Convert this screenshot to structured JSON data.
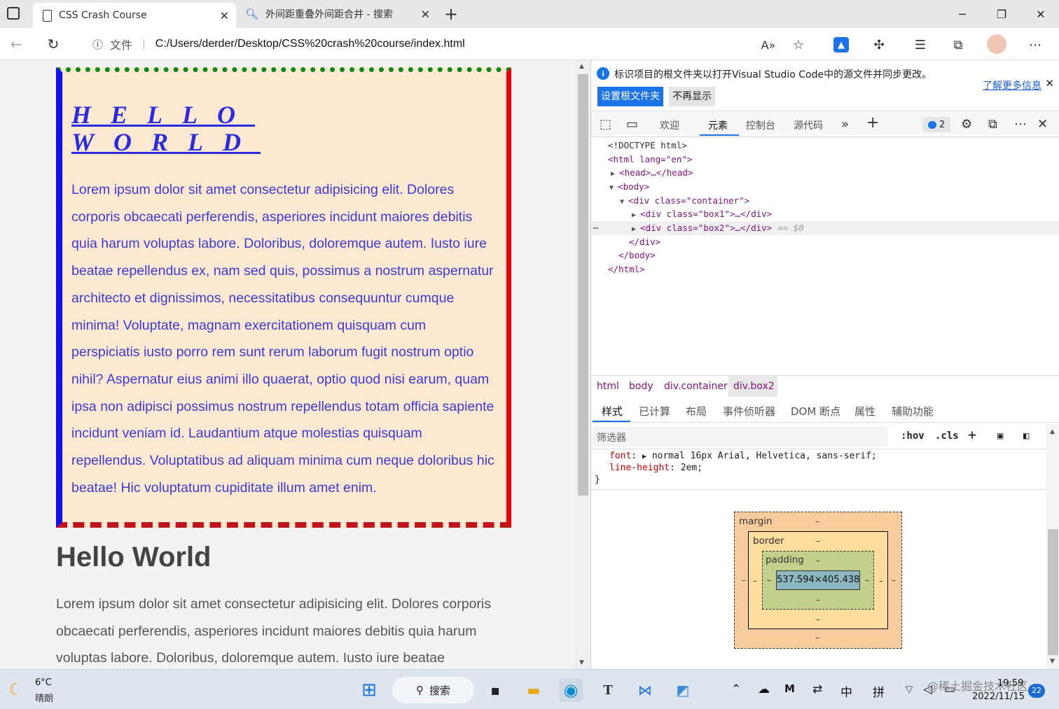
{
  "browser": {
    "tabs": [
      {
        "title": "CSS Crash Course",
        "active": true
      },
      {
        "title": "外间距重叠外间距合并 - 搜索",
        "active": false
      }
    ],
    "address": {
      "file_label": "文件",
      "url": "C:/Users/derder/Desktop/CSS%20crash%20course/index.html"
    },
    "icons": [
      "read-aloud-icon",
      "favorite-add-icon",
      "extension-blue-icon",
      "extensions-icon",
      "favorites-icon",
      "collections-icon",
      "profile-avatar",
      "more-icon"
    ]
  },
  "page": {
    "box1_heading_line1": "HELLO",
    "box1_heading_line2": "WORLD",
    "box1_text": "Lorem ipsum dolor sit amet consectetur adipisicing elit. Dolores corporis obcaecati perferendis, asperiores incidunt maiores debitis quia harum voluptas labore. Doloribus, doloremque autem. Iusto iure beatae repellendus ex, nam sed quis, possimus a nostrum aspernatur architecto et dignissimos, necessitatibus consequuntur cumque minima! Voluptate, magnam exercitationem quisquam cum perspiciatis iusto porro rem sunt rerum laborum fugit nostrum optio nihil? Aspernatur eius animi illo quaerat, optio quod nisi earum, quam ipsa non adipisci possimus nostrum repellendus totam officia sapiente incidunt veniam id. Laudantium atque molestias quisquam repellendus. Voluptatibus ad aliquam minima cum neque doloribus hic beatae! Hic voluptatum cupiditate illum amet enim.",
    "box2_heading": "Hello World",
    "box2_text": "Lorem ipsum dolor sit amet consectetur adipisicing elit. Dolores corporis obcaecati perferendis, asperiores incidunt maiores debitis quia harum voluptas labore. Doloribus, doloremque autem. Iusto iure beatae",
    "colors": {
      "box_bg": "#fde8d2",
      "border_top": "#0a8a1a",
      "border_right": "#e00000",
      "border_bottom": "#c0161b",
      "border_left": "#1010ee",
      "text_blue": "#3b3bd8"
    }
  },
  "devtools": {
    "info_message": "标识项目的根文件夹以打开Visual Studio Code中的源文件并同步更改。",
    "learn_more": "了解更多信息",
    "btn_set_root": "设置根文件夹",
    "btn_dont_show": "不再显示",
    "tabs": [
      "欢迎",
      "元素",
      "控制台",
      "源代码"
    ],
    "active_tab": "元素",
    "issues_count": "2",
    "dom_lines": [
      "<!DOCTYPE html>",
      "<html lang=\"en\">",
      "<head>…</head>",
      "<body>",
      "<div class=\"container\">",
      "<div class=\"box1\">…</div>",
      "<div class=\"box2\">…</div>",
      "== $0",
      "</div>",
      "</body>",
      "</html>"
    ],
    "breadcrumbs": [
      "html",
      "body",
      "div.container",
      "div.box2"
    ],
    "subtabs": [
      "样式",
      "已计算",
      "布局",
      "事件侦听器",
      "DOM 断点",
      "属性",
      "辅助功能"
    ],
    "filter_placeholder": "筛选器",
    "filter_buttons": [
      ":hov",
      ".cls"
    ],
    "style_lines": [
      {
        "prop": "font",
        "value": "normal 16px Arial, Helvetica, sans-serif;"
      },
      {
        "prop": "line-height",
        "value": "2em;"
      }
    ],
    "closing_brace": "}",
    "box_model": {
      "margin_label": "margin",
      "border_label": "border",
      "padding_label": "padding",
      "content_size": "537.594×405.438",
      "dash": "–"
    }
  },
  "taskbar": {
    "weather_temp": "6°C",
    "weather_desc": "晴朗",
    "search_label": "搜索",
    "ime_lang": "中",
    "ime_mode": "拼",
    "time": "19:59",
    "date": "2022/11/15",
    "notif_count": "22",
    "watermark": "@稀土掘金技术社区"
  }
}
